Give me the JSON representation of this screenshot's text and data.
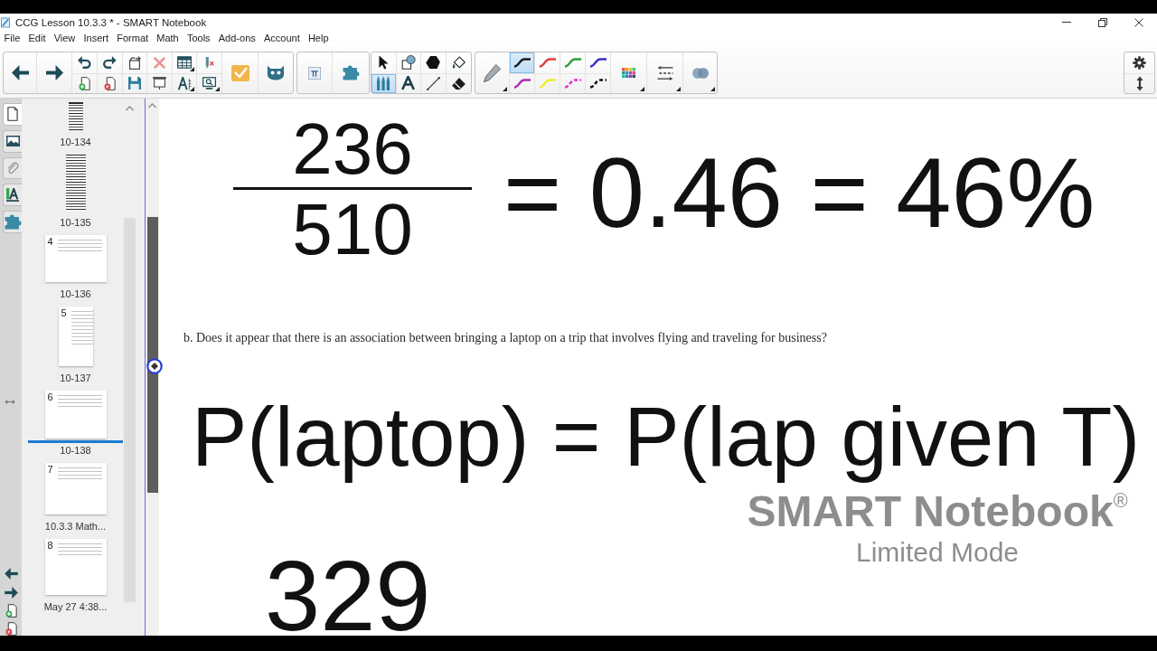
{
  "window": {
    "title": "CCG Lesson 10.3.3 * - SMART Notebook"
  },
  "menu": [
    "File",
    "Edit",
    "View",
    "Insert",
    "Format",
    "Math",
    "Tools",
    "Add-ons",
    "Account",
    "Help"
  ],
  "toolbar": {
    "tools": [
      {
        "selected": false
      },
      {
        "selected": false
      },
      {
        "selected": false
      },
      {
        "selected": false
      },
      {
        "selected": true
      },
      {
        "selected": false
      },
      {
        "selected": false
      },
      {
        "selected": false
      }
    ],
    "pens": [
      {
        "kind": "solid",
        "color": "#1c1c1c",
        "selected": true
      },
      {
        "kind": "solid",
        "color": "#e03c3c",
        "selected": false
      },
      {
        "kind": "solid",
        "color": "#2f9e3a",
        "selected": false
      },
      {
        "kind": "solid",
        "color": "#3b2fc9",
        "selected": false
      },
      {
        "kind": "solid",
        "color": "#b02cb0",
        "selected": false
      },
      {
        "kind": "solid",
        "color": "#eded2a",
        "selected": false
      },
      {
        "kind": "dashed",
        "color": "#e52ad8",
        "selected": false
      },
      {
        "kind": "dashed",
        "color": "#111111",
        "selected": false
      }
    ]
  },
  "side_tabs": [
    {
      "selected": true
    },
    {
      "selected": false
    },
    {
      "selected": false
    },
    {
      "selected": false
    },
    {
      "selected": false
    }
  ],
  "page_sorter": {
    "pages": [
      {
        "kind": "strip",
        "label": "10-134",
        "selected": false
      },
      {
        "kind": "strip",
        "label": "10-135",
        "selected": false
      },
      {
        "kind": "landscape",
        "number": "4",
        "label": "10-136",
        "selected": false
      },
      {
        "kind": "portrait",
        "number": "5",
        "label": "10-137",
        "selected": false
      },
      {
        "kind": "landscape",
        "number": "6",
        "label": "10-138",
        "selected": true
      },
      {
        "kind": "landscape",
        "number": "7",
        "label": "10.3.3 Math...",
        "selected": false
      },
      {
        "kind": "landscape",
        "number": "8",
        "label": "May 27 4:38...",
        "selected": false
      }
    ]
  },
  "canvas": {
    "items": [
      {
        "kind": "fraction",
        "numerator": "236",
        "denominator": "510"
      },
      {
        "kind": "ink",
        "text": "= 0.46 = 46%"
      },
      {
        "kind": "typed",
        "text": "b. Does it appear that there is an association between bringing a laptop on a trip that involves flying and traveling for business?"
      },
      {
        "kind": "ink",
        "text": "P(laptop) = P(lap given T)"
      },
      {
        "kind": "ink",
        "text": "329"
      }
    ],
    "notice": {
      "title": "SMART Notebook$^{®}$",
      "subtitle": "Limited Mode"
    }
  }
}
